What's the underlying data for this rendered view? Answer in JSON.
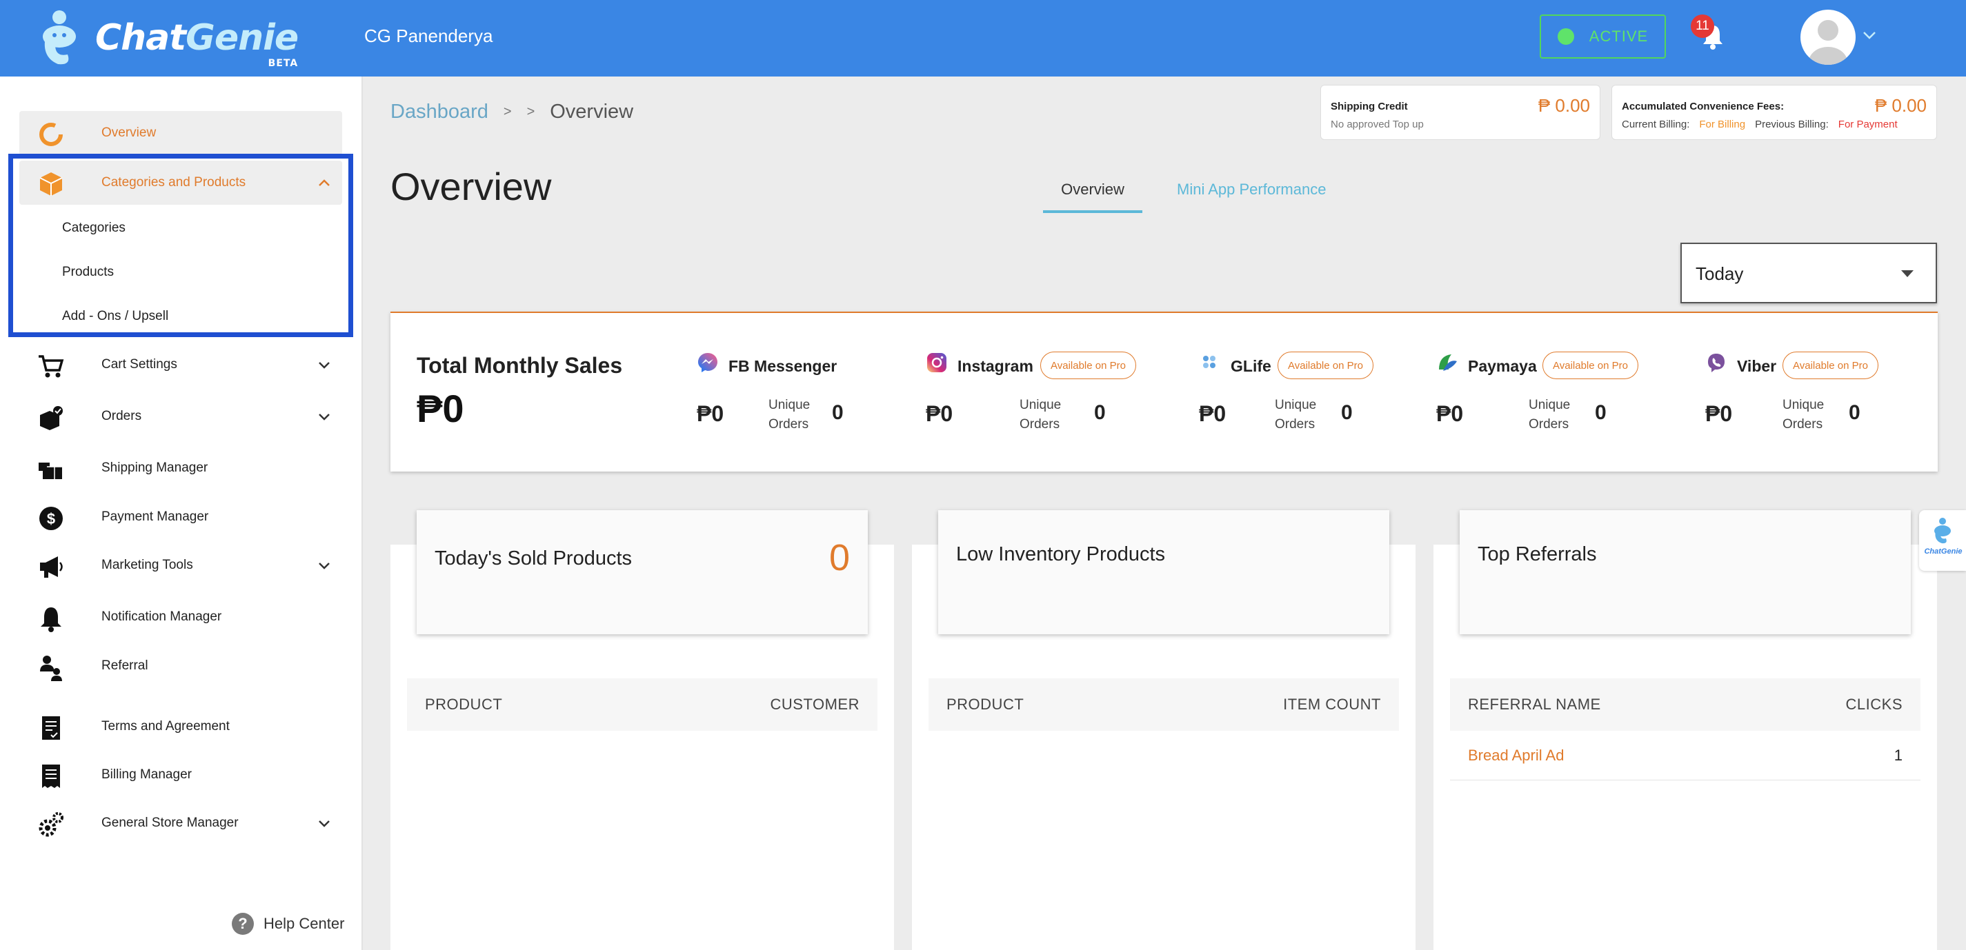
{
  "header": {
    "logo_text_chat": "Chat",
    "logo_text_genie": "Genie",
    "logo_badge": "BETA",
    "store_name": "CG Panenderya",
    "status_label": "ACTIVE",
    "notification_count": "11"
  },
  "sidebar": {
    "items": [
      {
        "label": "Overview",
        "icon": "overview-icon"
      },
      {
        "label": "Categories and Products",
        "icon": "box-icon"
      },
      {
        "label": "Cart Settings",
        "icon": "cart-icon"
      },
      {
        "label": "Orders",
        "icon": "orders-icon"
      },
      {
        "label": "Shipping Manager",
        "icon": "shipping-icon"
      },
      {
        "label": "Payment Manager",
        "icon": "dollar-icon"
      },
      {
        "label": "Marketing Tools",
        "icon": "megaphone-icon"
      },
      {
        "label": "Notification Manager",
        "icon": "bell-icon"
      },
      {
        "label": "Referral",
        "icon": "referral-icon"
      },
      {
        "label": "Terms and Agreement",
        "icon": "document-icon"
      },
      {
        "label": "Billing Manager",
        "icon": "receipt-icon"
      },
      {
        "label": "General Store Manager",
        "icon": "gears-icon"
      }
    ],
    "subitems": [
      "Categories",
      "Products",
      "Add - Ons / Upsell"
    ],
    "help_label": "Help Center"
  },
  "breadcrumb": {
    "root": "Dashboard",
    "sep1": ">",
    "sep2": ">",
    "current": "Overview"
  },
  "shipping_credit": {
    "title": "Shipping Credit",
    "amount": "₱ 0.00",
    "note": "No approved Top up"
  },
  "convenience_fees": {
    "title": "Accumulated Convenience Fees:",
    "amount": "₱ 0.00",
    "current_label": "Current Billing:",
    "current_value": "For Billing",
    "previous_label": "Previous Billing:",
    "previous_value": "For Payment"
  },
  "page_title": "Overview",
  "tabs": [
    "Overview",
    "Mini App Performance"
  ],
  "period_select": "Today",
  "sales": {
    "title": "Total Monthly Sales",
    "total": "₱0",
    "unique_orders_label_1": "Unique",
    "unique_orders_label_2": "Orders",
    "channels": [
      {
        "name": "FB Messenger",
        "amount": "₱0",
        "orders": "0",
        "pro": ""
      },
      {
        "name": "Instagram",
        "amount": "₱0",
        "orders": "0",
        "pro": "Available on Pro"
      },
      {
        "name": "GLife",
        "amount": "₱0",
        "orders": "0",
        "pro": "Available on Pro"
      },
      {
        "name": "Paymaya",
        "amount": "₱0",
        "orders": "0",
        "pro": "Available on Pro"
      },
      {
        "name": "Viber",
        "amount": "₱0",
        "orders": "0",
        "pro": "Available on Pro"
      }
    ]
  },
  "panels": [
    {
      "title": "Today's Sold Products",
      "count": "0",
      "col1": "PRODUCT",
      "col2": "CUSTOMER"
    },
    {
      "title": "Low Inventory Products",
      "count": "",
      "col1": "PRODUCT",
      "col2": "ITEM COUNT"
    },
    {
      "title": "Top Referrals",
      "count": "",
      "col1": "REFERRAL NAME",
      "col2": "CLICKS"
    }
  ],
  "referrals": [
    {
      "name": "Bread April Ad",
      "clicks": "1"
    }
  ],
  "chat_widget_label": "ChatGenie",
  "colors": {
    "header_blue": "#3a86e4",
    "accent_orange": "#e07b2c",
    "active_green": "#5fe36a",
    "highlight_blue": "#1f4fd1"
  }
}
